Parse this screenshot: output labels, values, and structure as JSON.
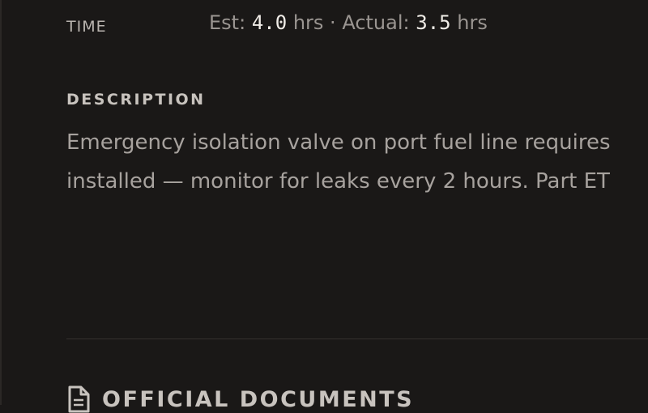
{
  "time": {
    "label": "TIME",
    "est_label": "Est:",
    "est_value": "4.0",
    "est_unit": "hrs",
    "separator": "·",
    "actual_label": "Actual:",
    "actual_value": "3.5",
    "actual_unit": "hrs"
  },
  "description": {
    "heading": "DESCRIPTION",
    "line1": "Emergency isolation valve on port fuel line requires",
    "line2": "installed — monitor for leaks every 2 hours. Part ET"
  },
  "documents": {
    "heading": "OFFICIAL DOCUMENTS",
    "icon": "document-icon"
  }
}
